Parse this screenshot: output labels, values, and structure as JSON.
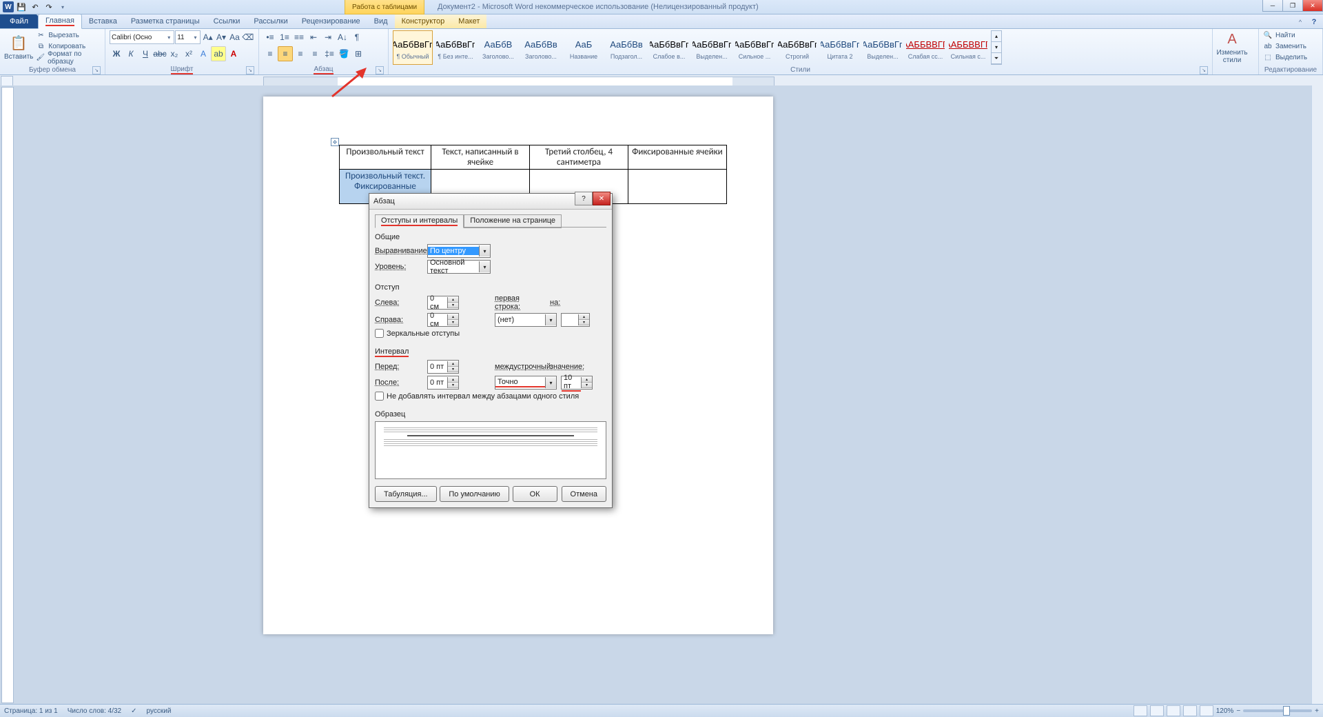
{
  "titlebar": {
    "contextual_label": "Работа с таблицами",
    "doc_title": "Документ2 - Microsoft Word некоммерческое использование (Нелицензированный продукт)"
  },
  "tabs": {
    "file": "Файл",
    "items": [
      "Главная",
      "Вставка",
      "Разметка страницы",
      "Ссылки",
      "Рассылки",
      "Рецензирование",
      "Вид",
      "Конструктор",
      "Макет"
    ]
  },
  "ribbon": {
    "clipboard": {
      "label": "Буфер обмена",
      "paste": "Вставить",
      "cut": "Вырезать",
      "copy": "Копировать",
      "format_painter": "Формат по образцу"
    },
    "font": {
      "label": "Шрифт",
      "font_name": "Calibri (Осно",
      "font_size": "11"
    },
    "paragraph": {
      "label": "Абзац"
    },
    "styles": {
      "label": "Стили",
      "items": [
        {
          "preview": "АаБбВвГг,",
          "name": "¶ Обычный",
          "sel": true
        },
        {
          "preview": "АаБбВвГг,",
          "name": "¶ Без инте..."
        },
        {
          "preview": "АаБбВ",
          "name": "Заголово...",
          "blue": true
        },
        {
          "preview": "АаБбВв",
          "name": "Заголово...",
          "blue": true
        },
        {
          "preview": "АаБ",
          "name": "Название",
          "blue": true
        },
        {
          "preview": "АаБбВв",
          "name": "Подзагол...",
          "blue": true
        },
        {
          "preview": "АаБбВвГг,",
          "name": "Слабое в..."
        },
        {
          "preview": "АаБбВвГг,",
          "name": "Выделен..."
        },
        {
          "preview": "АаБбВвГг,",
          "name": "Сильное ..."
        },
        {
          "preview": "АаБбВвГг",
          "name": "Строгий"
        },
        {
          "preview": "АаБбВвГг,",
          "name": "Цитата 2",
          "blue": true
        },
        {
          "preview": "АаБбВвГг,",
          "name": "Выделен...",
          "blue": true
        },
        {
          "preview": "ААББВВГГ,",
          "name": "Слабая сс...",
          "red": true,
          "ul": true
        },
        {
          "preview": "ААББВВГГ,",
          "name": "Сильная с...",
          "red": true,
          "ul": true
        }
      ],
      "change_styles": "Изменить стили"
    },
    "editing": {
      "label": "Редактирование",
      "find": "Найти",
      "replace": "Заменить",
      "select": "Выделить"
    }
  },
  "table": {
    "r1": [
      "Произвольный текст",
      "Текст, написанный в ячейке",
      "Третий столбец, 4 сантиметра",
      "Фиксированные ячейки"
    ],
    "r2": [
      "Произвольный текст. Фиксированные ячейки",
      "",
      "",
      ""
    ]
  },
  "dialog": {
    "title": "Абзац",
    "tab1": "Отступы и интервалы",
    "tab2": "Положение на странице",
    "sec_general": "Общие",
    "lbl_align": "Выравнивание:",
    "val_align": "По центру",
    "lbl_level": "Уровень:",
    "val_level": "Основной текст",
    "sec_indent": "Отступ",
    "lbl_left": "Слева:",
    "val_left": "0 см",
    "lbl_right": "Справа:",
    "val_right": "0 см",
    "lbl_firstline": "первая строка:",
    "val_firstline": "(нет)",
    "lbl_by": "на:",
    "chk_mirror": "Зеркальные отступы",
    "sec_spacing": "Интервал",
    "lbl_before": "Перед:",
    "val_before": "0 пт",
    "lbl_after": "После:",
    "val_after": "0 пт",
    "lbl_linespacing": "междустрочный:",
    "val_linespacing": "Точно",
    "lbl_at": "значение:",
    "val_at": "10 пт",
    "chk_nospace": "Не добавлять интервал между абзацами одного стиля",
    "sec_preview": "Образец",
    "btn_tabs": "Табуляция...",
    "btn_default": "По умолчанию",
    "btn_ok": "ОК",
    "btn_cancel": "Отмена"
  },
  "status": {
    "page": "Страница: 1 из 1",
    "words": "Число слов: 4/32",
    "lang": "русский",
    "zoom": "120%"
  }
}
